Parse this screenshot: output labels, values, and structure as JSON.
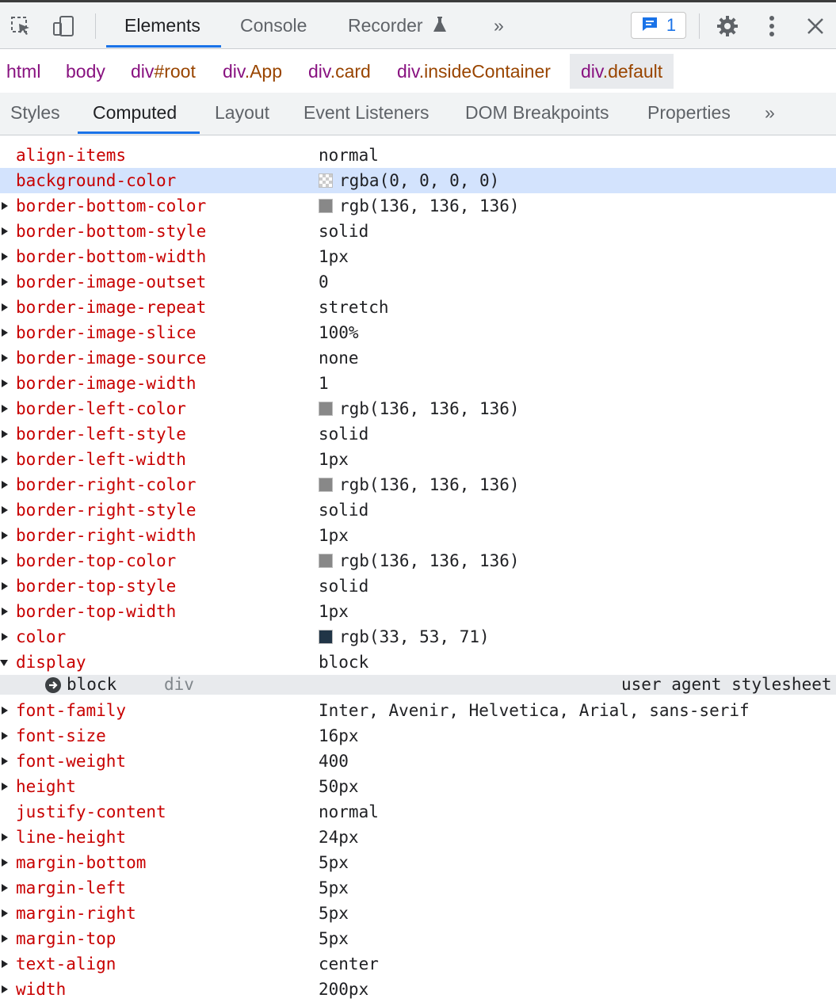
{
  "toolbar": {
    "tabs": [
      {
        "label": "Elements"
      },
      {
        "label": "Console"
      },
      {
        "label": "Recorder"
      }
    ],
    "more_tabs": "»",
    "issues_count": "1"
  },
  "breadcrumbs": [
    {
      "tag": "html",
      "cls": ""
    },
    {
      "tag": "body",
      "cls": ""
    },
    {
      "tag": "div",
      "cls": "#root"
    },
    {
      "tag": "div",
      "cls": ".App"
    },
    {
      "tag": "div",
      "cls": ".card"
    },
    {
      "tag": "div",
      "cls": ".insideContainer"
    },
    {
      "tag": "div",
      "cls": ".default"
    }
  ],
  "subtabs": [
    {
      "label": "Styles"
    },
    {
      "label": "Computed"
    },
    {
      "label": "Layout"
    },
    {
      "label": "Event Listeners"
    },
    {
      "label": "DOM Breakpoints"
    },
    {
      "label": "Properties"
    }
  ],
  "subtabs_more": "»",
  "properties": [
    {
      "name": "align-items",
      "value": "normal",
      "arrow": "none"
    },
    {
      "name": "background-color",
      "value": "rgba(0, 0, 0, 0)",
      "arrow": "none",
      "swatch": "transparent",
      "highlight": true
    },
    {
      "name": "border-bottom-color",
      "value": "rgb(136, 136, 136)",
      "arrow": "closed",
      "swatch": "#888888"
    },
    {
      "name": "border-bottom-style",
      "value": "solid",
      "arrow": "closed"
    },
    {
      "name": "border-bottom-width",
      "value": "1px",
      "arrow": "closed"
    },
    {
      "name": "border-image-outset",
      "value": "0",
      "arrow": "closed"
    },
    {
      "name": "border-image-repeat",
      "value": "stretch",
      "arrow": "closed"
    },
    {
      "name": "border-image-slice",
      "value": "100%",
      "arrow": "closed"
    },
    {
      "name": "border-image-source",
      "value": "none",
      "arrow": "closed"
    },
    {
      "name": "border-image-width",
      "value": "1",
      "arrow": "closed"
    },
    {
      "name": "border-left-color",
      "value": "rgb(136, 136, 136)",
      "arrow": "closed",
      "swatch": "#888888"
    },
    {
      "name": "border-left-style",
      "value": "solid",
      "arrow": "closed"
    },
    {
      "name": "border-left-width",
      "value": "1px",
      "arrow": "closed"
    },
    {
      "name": "border-right-color",
      "value": "rgb(136, 136, 136)",
      "arrow": "closed",
      "swatch": "#888888"
    },
    {
      "name": "border-right-style",
      "value": "solid",
      "arrow": "closed"
    },
    {
      "name": "border-right-width",
      "value": "1px",
      "arrow": "closed"
    },
    {
      "name": "border-top-color",
      "value": "rgb(136, 136, 136)",
      "arrow": "closed",
      "swatch": "#888888"
    },
    {
      "name": "border-top-style",
      "value": "solid",
      "arrow": "closed"
    },
    {
      "name": "border-top-width",
      "value": "1px",
      "arrow": "closed"
    },
    {
      "name": "color",
      "value": "rgb(33, 53, 71)",
      "arrow": "closed",
      "swatch": "#213547"
    },
    {
      "name": "display",
      "value": "block",
      "arrow": "open",
      "trace": {
        "value": "block",
        "selector": "div",
        "source": "user agent stylesheet"
      }
    },
    {
      "name": "font-family",
      "value": "Inter, Avenir, Helvetica, Arial, sans-serif",
      "arrow": "closed"
    },
    {
      "name": "font-size",
      "value": "16px",
      "arrow": "closed"
    },
    {
      "name": "font-weight",
      "value": "400",
      "arrow": "closed"
    },
    {
      "name": "height",
      "value": "50px",
      "arrow": "closed"
    },
    {
      "name": "justify-content",
      "value": "normal",
      "arrow": "none"
    },
    {
      "name": "line-height",
      "value": "24px",
      "arrow": "closed"
    },
    {
      "name": "margin-bottom",
      "value": "5px",
      "arrow": "closed"
    },
    {
      "name": "margin-left",
      "value": "5px",
      "arrow": "closed"
    },
    {
      "name": "margin-right",
      "value": "5px",
      "arrow": "closed"
    },
    {
      "name": "margin-top",
      "value": "5px",
      "arrow": "closed"
    },
    {
      "name": "text-align",
      "value": "center",
      "arrow": "closed"
    },
    {
      "name": "width",
      "value": "200px",
      "arrow": "closed"
    }
  ]
}
